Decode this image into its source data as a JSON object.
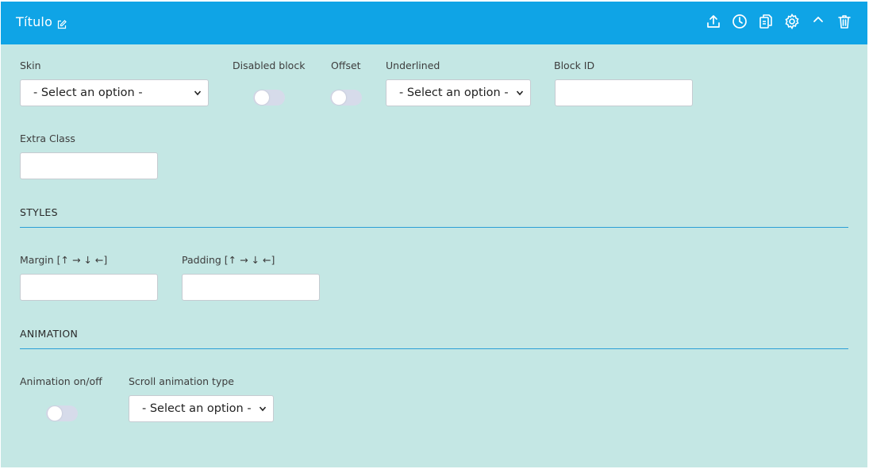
{
  "header": {
    "title": "Título",
    "tools": [
      "export-icon",
      "history-icon",
      "copy-icon",
      "settings-icon",
      "collapse-icon",
      "delete-icon"
    ]
  },
  "fields": {
    "skin": {
      "label": "Skin",
      "value": "- Select an option -"
    },
    "disabled_block": {
      "label": "Disabled block",
      "on": false
    },
    "offset": {
      "label": "Offset",
      "on": false
    },
    "underlined": {
      "label": "Underlined",
      "value": "- Select an option -"
    },
    "block_id": {
      "label": "Block ID",
      "value": ""
    },
    "extra_class": {
      "label": "Extra Class",
      "value": ""
    }
  },
  "styles": {
    "title": "STYLES",
    "margin": {
      "label": "Margin [↑ → ↓ ←]",
      "value": ""
    },
    "padding": {
      "label": "Padding [↑ → ↓ ←]",
      "value": ""
    }
  },
  "animation": {
    "title": "ANIMATION",
    "toggle": {
      "label": "Animation on/off",
      "on": false
    },
    "scroll_type": {
      "label": "Scroll animation type",
      "value": "- Select an option -"
    }
  },
  "colors": {
    "header_bg": "#0fa4e6",
    "panel_bg": "#c4e7e4",
    "rule": "#2b9fd6",
    "toggle_off": "#d6dbea"
  }
}
